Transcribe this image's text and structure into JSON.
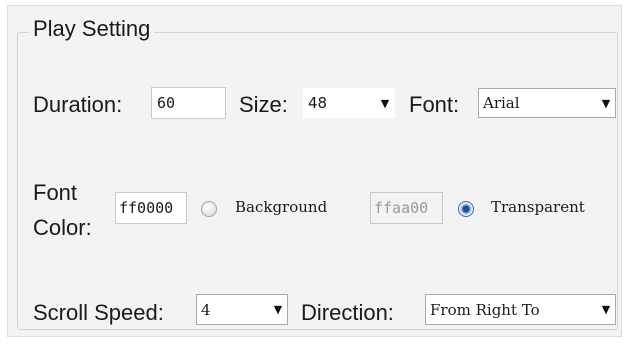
{
  "group": {
    "title": "Play Setting"
  },
  "duration": {
    "label": "Duration:",
    "value": "60"
  },
  "size": {
    "label": "Size:",
    "value": "48"
  },
  "font": {
    "label": "Font:",
    "value": "Arial"
  },
  "font_color": {
    "label_line1": "Font",
    "label_line2": "Color:",
    "value": "ff0000"
  },
  "background": {
    "label": "Background",
    "value": "ffaa00",
    "selected": false
  },
  "transparent": {
    "label": "Transparent",
    "selected": true
  },
  "scroll_speed": {
    "label": "Scroll Speed:",
    "value": "4"
  },
  "direction": {
    "label": "Direction:",
    "value": "From Right To"
  },
  "icons": {
    "dropdown": "chevron-down-icon"
  }
}
